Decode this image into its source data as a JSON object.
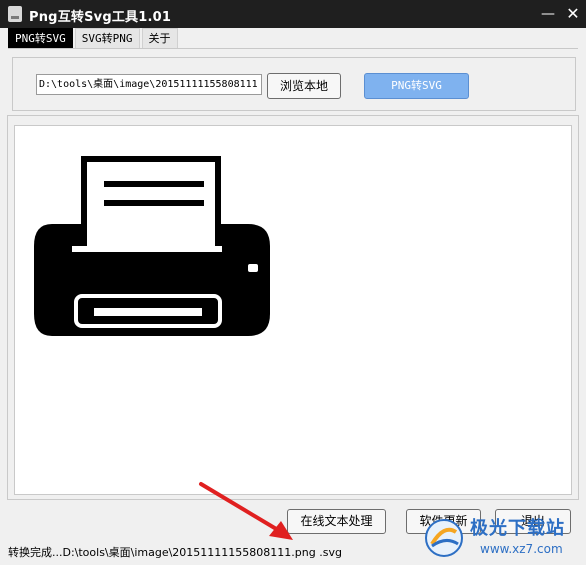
{
  "window": {
    "title": "Png互转Svg工具1.01",
    "minimize_glyph": "—",
    "close_glyph": "✕"
  },
  "tabs": [
    {
      "label": "PNG转SVG",
      "active": true
    },
    {
      "label": "SVG转PNG",
      "active": false
    },
    {
      "label": "关于",
      "active": false
    }
  ],
  "toolbar": {
    "path_value": "D:\\tools\\桌面\\image\\20151111155808111",
    "browse_label": "浏览本地",
    "convert_label": "PNG转SVG"
  },
  "preview": {
    "image_icon": "printer-icon"
  },
  "footer": {
    "online_text_label": "在线文本处理",
    "update_label": "软件更新",
    "exit_label": "退出"
  },
  "status": {
    "text": "转换完成...D:\\tools\\桌面\\image\\20151111155808111.png .svg"
  },
  "watermark": {
    "text": "极光下载站",
    "url": "www.xz7.com"
  },
  "colors": {
    "titlebar": "#1f1f1f",
    "convert_button": "#7fb2ef",
    "arrow": "#e02020",
    "watermark": "#2d6fc4"
  }
}
